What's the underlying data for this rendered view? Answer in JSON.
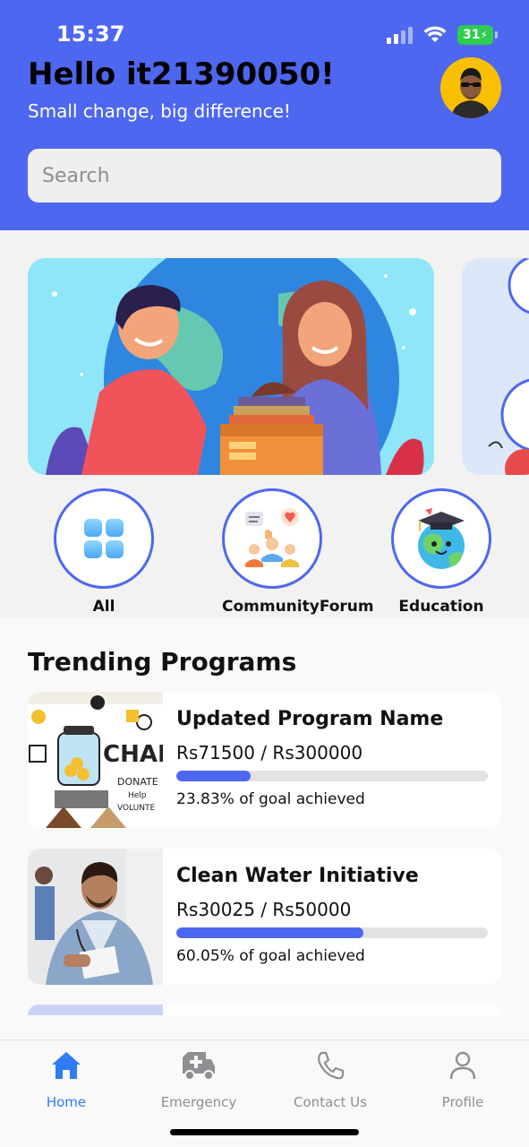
{
  "status_bar": {
    "time": "15:37",
    "battery": "31"
  },
  "header": {
    "greeting": "Hello it21390050!",
    "subtitle": "Small change, big difference!"
  },
  "search": {
    "placeholder": "Search",
    "value": ""
  },
  "categories": [
    {
      "label": "All",
      "icon": "grid-icon"
    },
    {
      "label": "CommunityForum",
      "icon": "community-forum-icon"
    },
    {
      "label": "Education",
      "icon": "education-globe-icon"
    }
  ],
  "trending": {
    "title": "Trending Programs",
    "programs": [
      {
        "name": "Updated Program Name",
        "amount": "Rs71500 / Rs300000",
        "progress": 0.2383,
        "achieved": "23.83% of goal achieved",
        "image_label": "CHARIT"
      },
      {
        "name": "Clean Water Initiative",
        "amount": "Rs30025 / Rs50000",
        "progress": 0.6005,
        "achieved": "60.05% of goal achieved"
      }
    ]
  },
  "tabs": [
    {
      "label": "Home",
      "icon": "home-icon",
      "active": true
    },
    {
      "label": "Emergency",
      "icon": "ambulance-icon",
      "active": false
    },
    {
      "label": "Contact Us",
      "icon": "phone-icon",
      "active": false
    },
    {
      "label": "Profile",
      "icon": "person-icon",
      "active": false
    }
  ],
  "colors": {
    "primary": "#4e67f0",
    "tab_active": "#2f7cf6",
    "tab_inactive": "#8e8e93",
    "battery": "#2ecc50"
  }
}
